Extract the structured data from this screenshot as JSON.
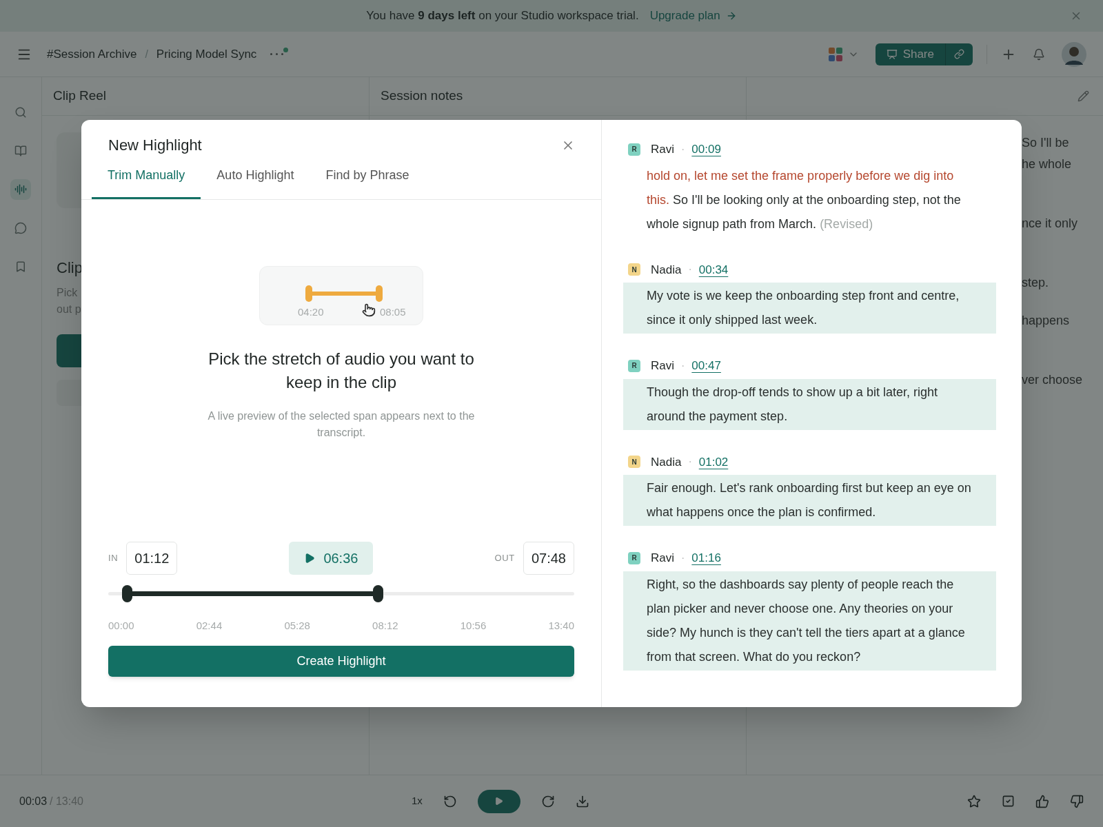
{
  "banner": {
    "message": "You have **9 days left** on your Studio workspace trial.",
    "link": "Upgrade plan"
  },
  "header": {
    "breadcrumb": [
      "#Session Archive",
      "Pricing Model Sync"
    ],
    "separator": "/",
    "share": "Share"
  },
  "rail": [
    {
      "selected": false
    },
    {
      "selected": false
    },
    {
      "selected": true
    },
    {
      "selected": false
    },
    {
      "selected": false
    }
  ],
  "columns": [
    {
      "title": "Clip Reel",
      "fragments": [
        "Clip",
        "Pick",
        "out p"
      ]
    },
    {
      "title": "Session notes"
    },
    {
      "fragments": [
        "So I'll be",
        "he whole",
        "nce it only",
        "step.",
        "happens",
        "ver choose"
      ]
    }
  ],
  "modal": {
    "title": "New Highlight",
    "tabs": [
      {
        "label": "Trim Manually",
        "selected": true
      },
      {
        "label": "Auto Highlight",
        "selected": false
      },
      {
        "label": "Find by Phrase",
        "selected": false
      }
    ],
    "preview": {
      "start": "04:20",
      "end": "08:05"
    },
    "heading": "Pick the stretch of audio you want to keep in the clip",
    "subtext": "A live preview of the selected span appears next to the transcript.",
    "in_label": "IN",
    "in_value": "01:12",
    "duration": "06:36",
    "out_label": "OUT",
    "out_value": "07:48",
    "slider": {
      "handles": [
        {
          "level": 0.04
        },
        {
          "level": 0.578
        }
      ]
    },
    "ticks": [
      "00:00",
      "02:44",
      "05:28",
      "08:12",
      "10:56",
      "13:40"
    ],
    "button": "Create Highlight"
  },
  "transcript_separator": "·",
  "transcript": [
    {
      "initial": "R",
      "speaker": "Ravi",
      "color": "#7fd1c0",
      "time": "00:09",
      "highlighted": false,
      "parts": [
        {
          "kind": "flagged",
          "text": "hold on, let me set the frame properly before we dig into this."
        },
        {
          "kind": "plain",
          "text": " So I'll be looking only at the onboarding step, not the whole signup path from March. "
        },
        {
          "kind": "note",
          "text": "(Revised)"
        }
      ]
    },
    {
      "initial": "N",
      "speaker": "Nadia",
      "color": "#f3d58a",
      "time": "00:34",
      "highlighted": true,
      "parts": [
        {
          "kind": "plain",
          "text": "My vote is we keep the onboarding step front and centre, since it only shipped last week."
        }
      ]
    },
    {
      "initial": "R",
      "speaker": "Ravi",
      "color": "#7fd1c0",
      "time": "00:47",
      "highlighted": true,
      "parts": [
        {
          "kind": "plain",
          "text": "Though the drop-off tends to show up a bit later, right around the payment step."
        }
      ]
    },
    {
      "initial": "N",
      "speaker": "Nadia",
      "color": "#f3d58a",
      "time": "01:02",
      "highlighted": true,
      "parts": [
        {
          "kind": "plain",
          "text": "Fair enough. Let's rank onboarding first but keep an eye on what happens once the plan is confirmed."
        }
      ]
    },
    {
      "initial": "R",
      "speaker": "Ravi",
      "color": "#7fd1c0",
      "time": "01:16",
      "highlighted": true,
      "parts": [
        {
          "kind": "plain",
          "text": "Right, so the dashboards say plenty of people reach the plan picker and never choose one. Any theories on your side? My hunch is they can't tell the tiers apart at a glance from that screen. What do you reckon?"
        }
      ]
    }
  ],
  "player": {
    "time": "00:03",
    "total": "/ 13:40",
    "speed": "1x"
  }
}
